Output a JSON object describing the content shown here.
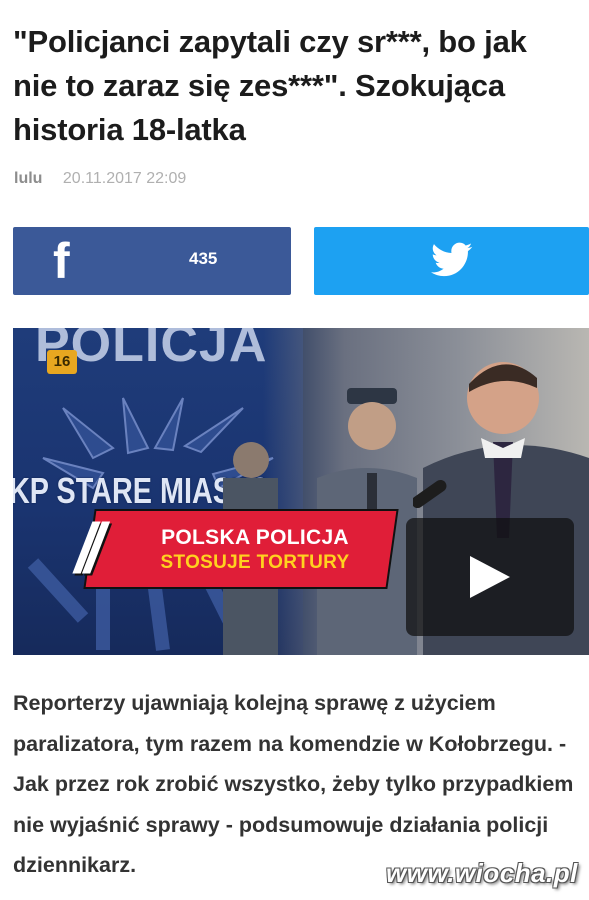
{
  "article": {
    "title": "\"Policjanci zapytali czy sr***, bo jak nie to zaraz się zes***\". Szokująca historia 18-latka",
    "author": "lulu",
    "date": "20.11.2017 22:09",
    "lead": "Reporterzy ujawniają kolejną sprawę z użyciem paralizatora, tym razem na komendzie w Kołobrzegu. - Jak przez rok zrobić wszystko, żeby tylko przypadkiem nie wyjaśnić sprawy - podsumowuje działania policji dziennikarz."
  },
  "share": {
    "facebook_icon": "f",
    "facebook_count": "435",
    "facebook_color": "#3b5998",
    "twitter_color": "#1da1f2"
  },
  "video": {
    "badge": "16",
    "background_text_top": "POLICJA",
    "background_text_mid": "KP STARE MIASTO",
    "headline_line1": "POLSKA POLICJA",
    "headline_line2": "STOSUJE TORTURY",
    "headline_bg_color": "#e01e38",
    "headline_accent_color": "#ffd21f",
    "play_icon": "play-icon"
  },
  "watermark": "www.wiocha.pl"
}
